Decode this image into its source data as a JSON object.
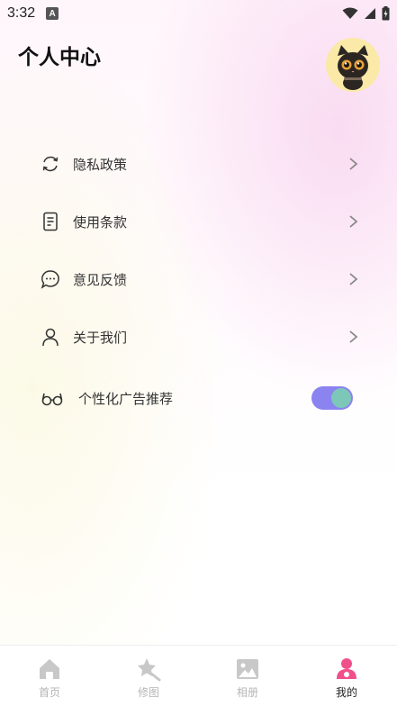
{
  "status": {
    "time": "3:32",
    "app_badge": "A"
  },
  "header": {
    "title": "个人中心"
  },
  "menu": {
    "items": [
      {
        "label": "隐私政策",
        "icon": "refresh-icon"
      },
      {
        "label": "使用条款",
        "icon": "document-icon"
      },
      {
        "label": "意见反馈",
        "icon": "chat-bubble-icon"
      },
      {
        "label": "关于我们",
        "icon": "person-icon"
      }
    ],
    "toggle": {
      "label": "个性化广告推荐",
      "icon": "glasses-icon",
      "enabled": true
    }
  },
  "colors": {
    "toggle_track": "#8b83f0",
    "toggle_knob": "#7dc7b8",
    "active_tab": "#f0508a",
    "inactive_tab": "#c8c8c8"
  },
  "nav": {
    "tabs": [
      {
        "label": "首页",
        "icon": "home-icon",
        "active": false
      },
      {
        "label": "修图",
        "icon": "star-edit-icon",
        "active": false
      },
      {
        "label": "相册",
        "icon": "image-icon",
        "active": false
      },
      {
        "label": "我的",
        "icon": "profile-icon",
        "active": true
      }
    ]
  }
}
